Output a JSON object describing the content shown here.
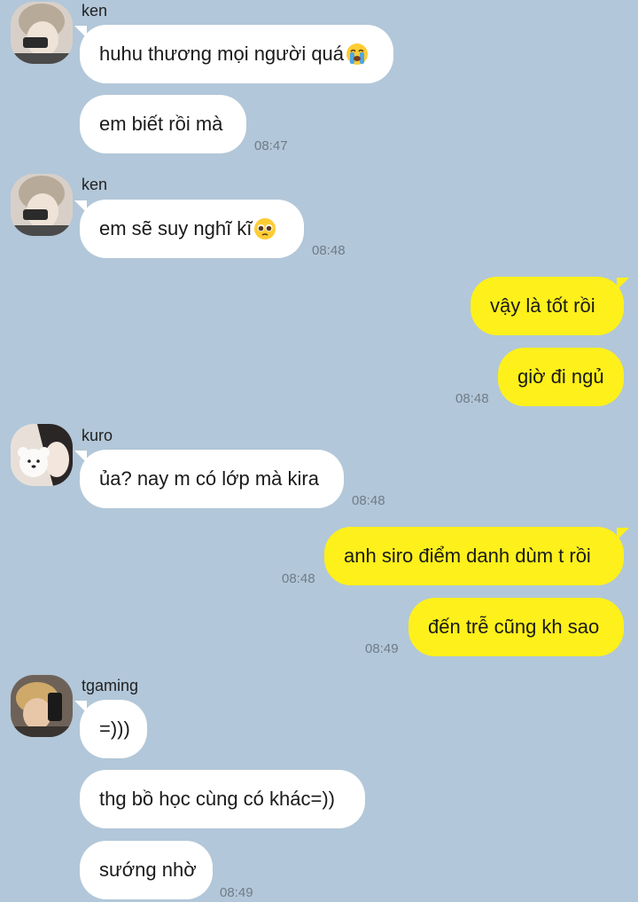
{
  "messages": [
    {
      "sender": "ken",
      "text": "huhu thương mọi người quá",
      "emoji": "loudly-crying-face-icon"
    },
    {
      "text": "em biết rồi mà",
      "time": "08:47"
    },
    {
      "sender": "ken",
      "text": "em sẽ suy nghĩ kĩ",
      "emoji": "pleading-face-icon",
      "time": "08:48"
    },
    {
      "text": "vậy là tốt rồi"
    },
    {
      "text": "giờ đi ngủ",
      "time": "08:48"
    },
    {
      "sender": "kuro",
      "text": "ủa? nay m có lớp mà kira",
      "time": "08:48"
    },
    {
      "text": "anh siro điểm danh dùm t rồi",
      "time": "08:48"
    },
    {
      "text": "đến trễ cũng kh sao",
      "time": "08:49"
    },
    {
      "sender": "tgaming",
      "text": "=)))"
    },
    {
      "text": "thg bồ học cùng có khác=))"
    },
    {
      "text": "sướng nhờ",
      "time": "08:49"
    }
  ],
  "colors": {
    "background": "#b2c7d9",
    "incoming_bubble": "#ffffff",
    "outgoing_bubble": "#fef01b",
    "timestamp": "#6f7c88"
  }
}
